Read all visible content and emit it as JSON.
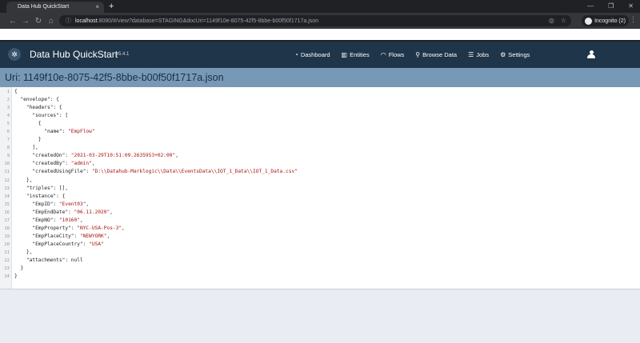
{
  "browser": {
    "tab_title": "Data Hub QuickStart",
    "tab_close": "×",
    "new_tab": "+",
    "win_min": "—",
    "win_max": "❐",
    "win_close": "✕",
    "url_host": "localhost",
    "url_rest": ":8080/#/view?database=STAGING&docUri=1149f10e-8075-42f5-8bbe-b00f50f1717a.json",
    "incognito_label": "Incognito (2)"
  },
  "app": {
    "title": "Data Hub QuickStart",
    "version": "v5.4.1",
    "nav": [
      {
        "label": "Dashboard",
        "icon": "dashboard-icon"
      },
      {
        "label": "Entities",
        "icon": "entities-icon"
      },
      {
        "label": "Flows",
        "icon": "flows-icon"
      },
      {
        "label": "Browse Data",
        "icon": "search-icon"
      },
      {
        "label": "Jobs",
        "icon": "jobs-icon"
      },
      {
        "label": "Settings",
        "icon": "gear-icon"
      }
    ]
  },
  "document": {
    "uri_label": "Uri: 1149f10e-8075-42f5-8bbe-b00f50f1717a.json",
    "lines": [
      "{",
      "  \"envelope\": {",
      "    \"headers\": {",
      "      \"sources\": [",
      "        {",
      "          \"name\": \"EmpFlow\"",
      "        }",
      "      ],",
      "      \"createdOn\": \"2021-03-29T10:51:09.2635953+02:00\",",
      "      \"createdBy\": \"admin\",",
      "      \"createdUsingFile\": \"D:\\\\Datahub-Marklogic\\\\Data\\\\EventsData\\\\IOT_1_Data\\\\IOT_1_Data.csv\"",
      "    },",
      "    \"triples\": [],",
      "    \"instance\": {",
      "      \"EmpID\": \"Event03\",",
      "      \"EmpEndDate\": \"06.11.2020\",",
      "      \"EmpNO\": \"10160\",",
      "      \"EmpProperty\": \"NYC-USA-Pos-3\",",
      "      \"EmpPlaceCity\": \"NEWYORK\",",
      "      \"EmpPlaceCountry\": \"USA\"",
      "    },",
      "    \"attachments\": null",
      "  }",
      "}"
    ]
  }
}
